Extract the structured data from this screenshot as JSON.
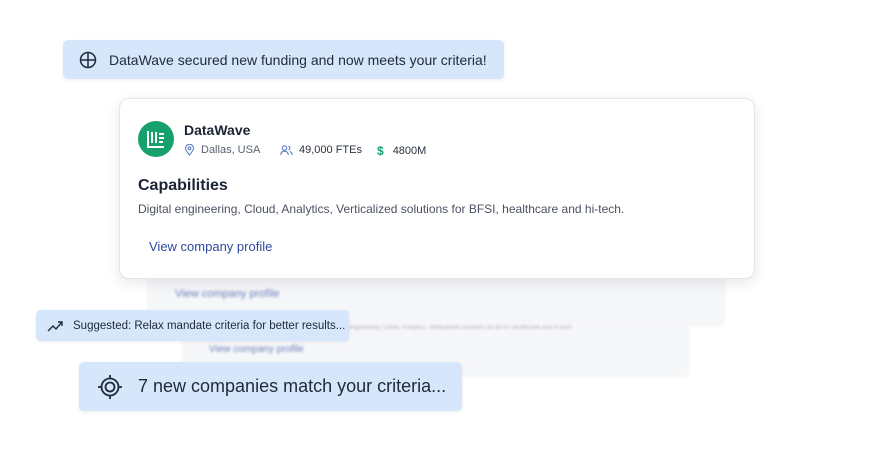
{
  "notifications": {
    "funding": "DataWave secured new funding and now meets your criteria!",
    "suggestion": "Suggested: Relax mandate criteria for better results...",
    "matches": "7 new companies match your criteria..."
  },
  "company": {
    "name": "DataWave",
    "location": "Dallas, USA",
    "employees": "49,000 FTEs",
    "revenue": "4800M",
    "capabilities_title": "Capabilities",
    "capabilities": "Digital engineering, Cloud, Analytics, Verticalized solutions for BFSI, healthcare and hi-tech.",
    "profile_link": "View company profile"
  },
  "background_cards": [
    {
      "link": "View company profile"
    },
    {
      "link": "View company profile",
      "snippet": "Digital engineering, Cloud, Analytics, Verticalized solutions for BFSI, healthcare and hi-tech"
    }
  ],
  "colors": {
    "toast_bg": "#d6e6fb",
    "brand_green": "#16a06b",
    "link": "#2d4aa0",
    "icon_blue": "#5b7fc7"
  }
}
